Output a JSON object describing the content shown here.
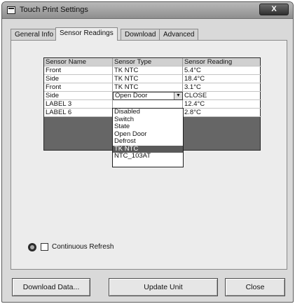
{
  "window": {
    "title": "Touch Print Settings",
    "close_glyph": "X"
  },
  "tabs": [
    {
      "label": "General Info"
    },
    {
      "label": "Sensor Readings"
    },
    {
      "label": "Download"
    },
    {
      "label": "Advanced"
    }
  ],
  "grid": {
    "headers": [
      "Sensor Name",
      "Sensor Type",
      "Sensor Reading"
    ],
    "rows": [
      [
        "Front",
        "TK NTC",
        "5.4°C"
      ],
      [
        "Side",
        "TK NTC",
        "18.4°C"
      ],
      [
        "Front",
        "TK NTC",
        "3.1°C"
      ],
      [
        "Side",
        "Open Door",
        "CLOSE"
      ],
      [
        "LABEL 3",
        "",
        "12.4°C"
      ],
      [
        "LABEL 6",
        "",
        "2.8°C"
      ]
    ]
  },
  "dropdown": {
    "options": [
      "Disabled",
      "Switch",
      "State",
      "Open Door",
      "Defrost",
      "TK NTC",
      "NTC_103AT"
    ],
    "selected": "TK NTC"
  },
  "refresh": {
    "label": "Continuous Refresh",
    "checked": false
  },
  "buttons": {
    "download": "Download Data...",
    "update": "Update Unit",
    "close": "Close"
  }
}
